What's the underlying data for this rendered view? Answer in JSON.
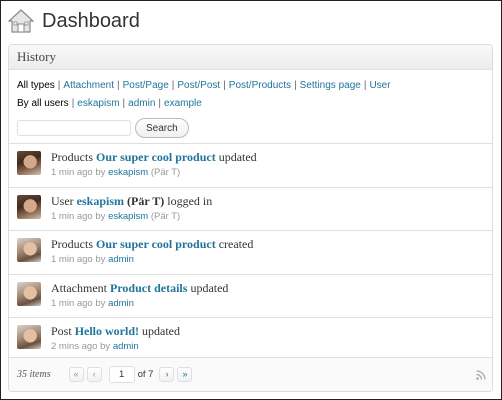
{
  "header": {
    "title": "Dashboard",
    "icon": "house-icon"
  },
  "widget": {
    "title": "History"
  },
  "filters": {
    "types": [
      "All types",
      "Attachment",
      "Post/Page",
      "Post/Post",
      "Post/Products",
      "Settings page",
      "User"
    ],
    "users": [
      "By all users",
      "eskapism",
      "admin",
      "example"
    ],
    "search_button": "Search",
    "search_value": ""
  },
  "items": [
    {
      "type": "Products",
      "object": "Our super cool product",
      "extra": "",
      "action": "updated",
      "time": "1 min ago",
      "by": "by",
      "user": "eskapism",
      "user_full": "(Pär T)"
    },
    {
      "type": "User",
      "object": "eskapism",
      "extra": "(Pär T)",
      "action": "logged in",
      "time": "1 min ago",
      "by": "by",
      "user": "eskapism",
      "user_full": "(Pär T)"
    },
    {
      "type": "Products",
      "object": "Our super cool product",
      "extra": "",
      "action": "created",
      "time": "1 min ago",
      "by": "by",
      "user": "admin",
      "user_full": ""
    },
    {
      "type": "Attachment",
      "object": "Product details",
      "extra": "",
      "action": "updated",
      "time": "1 min ago",
      "by": "by",
      "user": "admin",
      "user_full": ""
    },
    {
      "type": "Post",
      "object": "Hello world!",
      "extra": "",
      "action": "updated",
      "time": "2 mins ago",
      "by": "by",
      "user": "admin",
      "user_full": ""
    }
  ],
  "footer": {
    "count": "35 items",
    "first": "«",
    "prev": "‹",
    "page": "1",
    "of": "of 7",
    "next": "›",
    "last": "»"
  },
  "colors": {
    "link": "#21759b"
  }
}
